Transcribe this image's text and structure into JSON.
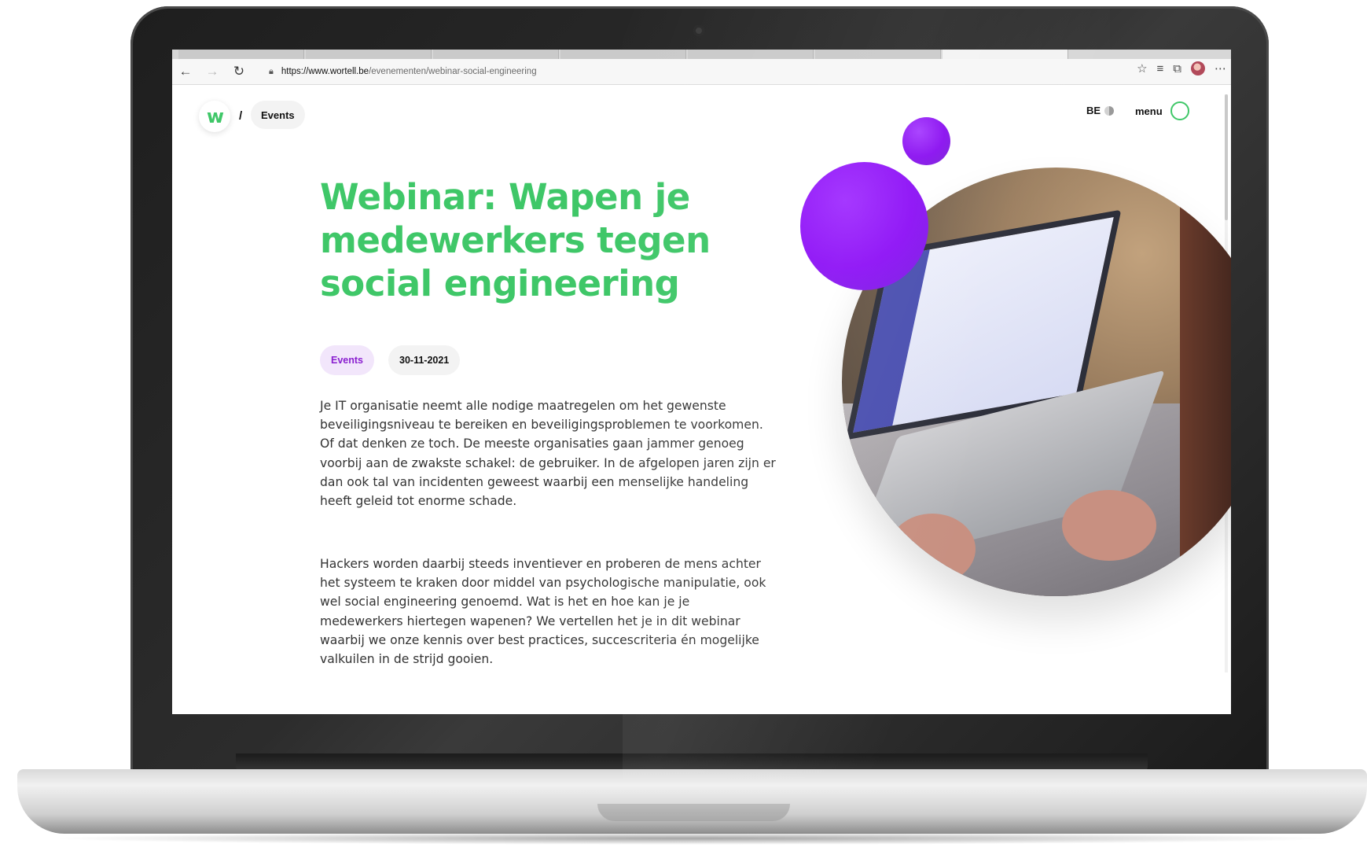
{
  "browser": {
    "url_host": "https://www.wortell.be",
    "url_path": "/evenementen/webinar-social-engineering"
  },
  "header": {
    "logo_text": "w",
    "breadcrumb_separator": "/",
    "breadcrumb_label": "Events",
    "language": "BE",
    "menu_label": "menu"
  },
  "article": {
    "title": "Webinar: Wapen je medewerkers tegen social engineering",
    "category_tag": "Events",
    "date": "30-11-2021",
    "paragraphs": [
      "Je IT organisatie neemt alle nodige maatregelen om het gewenste beveiligingsniveau te bereiken en beveiligingsproblemen te voorkomen. Of dat denken ze toch. De meeste organisaties gaan jammer genoeg voorbij aan de zwakste schakel: de gebruiker. In de afgelopen jaren zijn er dan ook tal van incidenten geweest waarbij een menselijke handeling heeft geleid tot enorme schade.",
      "Hackers worden daarbij steeds inventiever en proberen de mens achter het systeem te kraken door middel van psychologische manipulatie, ook wel social engineering genoemd. Wat is het en hoe kan je je medewerkers hiertegen wapenen? We vertellen het je in dit webinar waarbij we onze kennis over best practices, succescriteria én mogelijke valkuilen in de strijd gooien."
    ]
  },
  "colors": {
    "brand_green": "#3fc768",
    "accent_purple": "#8a10f0",
    "tag_purple_bg": "#f2e6fb"
  },
  "icons": {
    "back": "arrow-left-icon",
    "forward": "arrow-right-icon",
    "reload": "reload-icon",
    "lock": "lock-icon",
    "favorite": "star-add-icon",
    "favorites_list": "favorites-icon",
    "collections": "collections-icon",
    "more": "more-icon",
    "globe": "globe-icon"
  }
}
